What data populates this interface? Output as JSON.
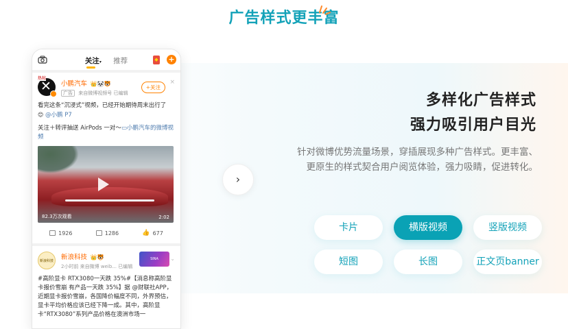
{
  "section": {
    "title": "广告样式更丰富"
  },
  "phone": {
    "tabs": [
      "关注",
      "推荐"
    ],
    "post1": {
      "tag_top": "热帖",
      "user": "小鹏汽车",
      "badges": "👑🐼🐯",
      "ad_tag": "广告",
      "meta": "来自微博视频号 已编辑",
      "follow_label": "+关注",
      "close": "×",
      "text_line1": "看完这条“沉浸式”视频，已经开始期待周末出行了",
      "text_line2_link": "@小鹏 P7",
      "text_line3": "关注＋转评抽送 AirPods 一对～",
      "text_line3_link": "小鹏汽车的微博视频",
      "views": "82.3万次观看",
      "duration": "2:02",
      "reposts": "1926",
      "comments": "1286",
      "likes": "677"
    },
    "post2": {
      "avatar_text": "新浪科技",
      "user": "新浪科技",
      "badges": "👑🐯",
      "meta": "2小时前 来自微博 weib... 已编辑",
      "banner_text": "SINA",
      "chevron": "⌄",
      "text": "#高阶显卡 RTX3080一天跌 35%#【消息称高阶显卡报价雪崩 有产品一天跌 35%】据 @财联社APP，近期显卡报价雪崩，各国降价幅度不同，外界预估，显卡平均价格应该已经下降一成。其中，高阶显卡“RTX3080”系列产品价格在澳洲市场一"
    }
  },
  "nav": {
    "next": "›"
  },
  "headline": {
    "line1": "多样化广告样式",
    "line2": "强力吸引用户目光"
  },
  "description": {
    "line1": "针对微博优势流量场景，穿插展现多种广告样式。更丰富、",
    "line2": "更原生的样式契合用户阅览体验，强力吸睛，促进转化。"
  },
  "styles": [
    {
      "label": "卡片",
      "active": false
    },
    {
      "label": "横版视频",
      "active": true
    },
    {
      "label": "竖版视频",
      "active": false
    },
    {
      "label": "短图",
      "active": false
    },
    {
      "label": "长图",
      "active": false
    },
    {
      "label": "正文页banner",
      "active": false
    }
  ],
  "colors": {
    "accent": "#13a2b8",
    "weibo_orange": "#ff8200"
  }
}
